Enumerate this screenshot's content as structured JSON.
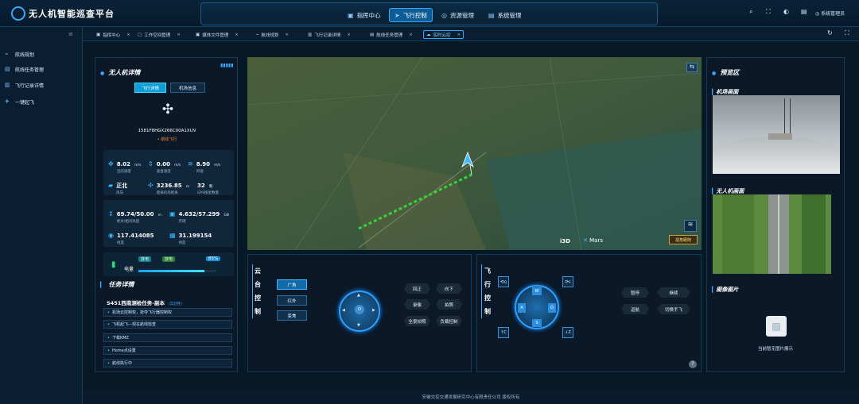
{
  "header": {
    "title": "无人机智能巡查平台",
    "nav": [
      {
        "label": "指挥中心",
        "icon": "monitor-icon"
      },
      {
        "label": "飞行控制",
        "icon": "plane-icon",
        "active": true
      },
      {
        "label": "资源管理",
        "icon": "database-icon"
      },
      {
        "label": "系统管理",
        "icon": "settings-icon"
      }
    ],
    "user": "系统管理员"
  },
  "sidebar": {
    "items": [
      {
        "label": "航线规划",
        "icon": "route-icon"
      },
      {
        "label": "航线任务管理",
        "icon": "task-icon"
      },
      {
        "label": "飞行记录详情",
        "icon": "record-icon"
      },
      {
        "label": "一键起飞",
        "icon": "takeoff-icon"
      }
    ]
  },
  "tabs": [
    {
      "label": "指挥中心"
    },
    {
      "label": "工作空间管理"
    },
    {
      "label": "媒体文件管理"
    },
    {
      "label": "航线规划"
    },
    {
      "label": "飞行记录详情"
    },
    {
      "label": "航线任务管理"
    },
    {
      "label": "实时云控",
      "active": true
    }
  ],
  "drone": {
    "title": "无人机详情",
    "tab_flight": "飞行详情",
    "tab_dock": "机场信息",
    "serial": "1581F8HGX266C00A1XUV",
    "status": "• 航线飞行",
    "stats1": [
      {
        "value": "8.02",
        "unit": "m/s",
        "label": "当前速度"
      },
      {
        "value": "0.00",
        "unit": "m/s",
        "label": "垂直速度"
      },
      {
        "value": "8.90",
        "unit": "m/s",
        "label": "风速"
      },
      {
        "value": "正北",
        "unit": "",
        "label": "风向"
      },
      {
        "value": "3236.85",
        "unit": "m",
        "label": "距离机场距离"
      },
      {
        "value": "32",
        "unit": "颗",
        "label": "GPS搜星数量"
      }
    ],
    "stats2": [
      {
        "value": "69.74/50.00",
        "unit": "m",
        "label": "绝对/相对高度"
      },
      {
        "value": "4.632/57.299",
        "unit": "GB",
        "label": "存储"
      },
      {
        "value": "117.414085",
        "unit": "",
        "label": "经度"
      },
      {
        "value": "31.199154",
        "unit": "",
        "label": "纬度"
      }
    ],
    "battery": {
      "label": "电量",
      "tag1": "放电",
      "tag2": "放电",
      "percent": "85%",
      "level": 0.85
    }
  },
  "task": {
    "title": "任务详情",
    "name": "S451西南测检任务-副本",
    "name_tag": "(实验性)",
    "steps": [
      "机场云控制权，抢夺飞行器控制权",
      "飞机起飞—现在航线检查",
      "下载KMZ",
      "Home点设置",
      "航线执行中"
    ]
  },
  "map": {
    "brand1": "i3D",
    "brand2": "Mars",
    "view_btn": "视角跟随"
  },
  "gimbal": {
    "label": "云台控制",
    "modes": [
      "广角",
      "红外",
      "变焦"
    ],
    "center": "O",
    "actions": [
      "回正",
      "向下",
      "录像",
      "拍照",
      "全景拍照",
      "负载控制"
    ]
  },
  "flight": {
    "label": "飞行控制",
    "keys": {
      "w": "W",
      "a": "A",
      "s": "S",
      "d": "D",
      "q": "Q",
      "e": "E",
      "c": "C",
      "z": "Z"
    },
    "actions": [
      "暂停",
      "继续",
      "返航",
      "切换手飞"
    ],
    "help": "?"
  },
  "preview": {
    "title": "预览区",
    "dock": "机场画面",
    "drone": "无人机画面",
    "images": "图像图片",
    "empty": "当前暂无图片展示"
  },
  "footer": "安徽交控交通发展研究中心有限责任公司 版权所有"
}
